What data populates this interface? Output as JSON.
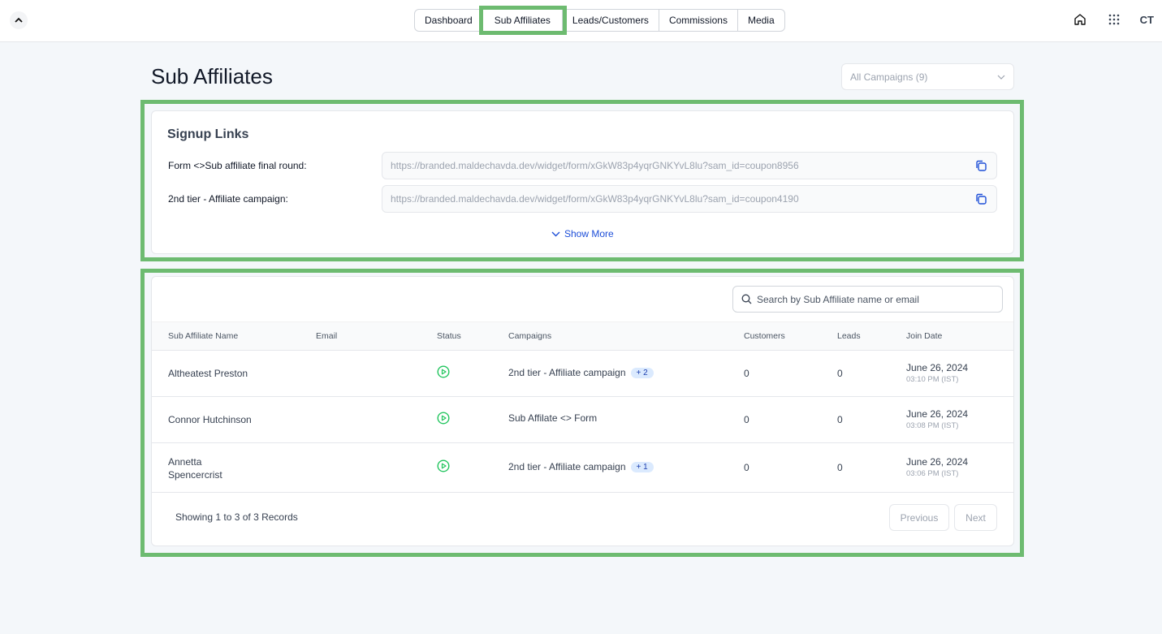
{
  "nav": {
    "tabs": [
      "Dashboard",
      "Sub Affiliates",
      "Leads/Customers",
      "Commissions",
      "Media"
    ],
    "active": "Sub Affiliates"
  },
  "header": {
    "avatar_initials": "CT"
  },
  "page": {
    "title": "Sub Affiliates",
    "campaign_filter": "All Campaigns (9)"
  },
  "signup": {
    "title": "Signup Links",
    "links": [
      {
        "label": "Form <>Sub affiliate final round:",
        "url": "https://branded.maldechavda.dev/widget/form/xGkW83p4yqrGNKYvL8lu?sam_id=coupon8956"
      },
      {
        "label": "2nd tier - Affiliate campaign:",
        "url": "https://branded.maldechavda.dev/widget/form/xGkW83p4yqrGNKYvL8lu?sam_id=coupon4190"
      }
    ],
    "show_more": "Show More"
  },
  "table": {
    "search_placeholder": "Search by Sub Affiliate name or email",
    "columns": {
      "name": "Sub Affiliate Name",
      "email": "Email",
      "status": "Status",
      "campaigns": "Campaigns",
      "customers": "Customers",
      "leads": "Leads",
      "join_date": "Join Date"
    },
    "rows": [
      {
        "name": "Altheatest Preston",
        "campaign": "2nd tier - Affiliate campaign",
        "extra": "+ 2",
        "customers": "0",
        "leads": "0",
        "date": "June 26, 2024",
        "time": "03:10 PM (IST)"
      },
      {
        "name": "Connor Hutchinson",
        "campaign": "Sub Affilate <> Form",
        "extra": "",
        "customers": "0",
        "leads": "0",
        "date": "June 26, 2024",
        "time": "03:08 PM (IST)"
      },
      {
        "name_line1": "Annetta",
        "name_line2": "Spencercrist",
        "campaign": "2nd tier - Affiliate campaign",
        "extra": "+ 1",
        "customers": "0",
        "leads": "0",
        "date": "June 26, 2024",
        "time": "03:06 PM (IST)"
      }
    ],
    "footer": "Showing 1 to 3 of 3 Records",
    "previous": "Previous",
    "next": "Next"
  },
  "colors": {
    "highlight": "#6dbb70",
    "status_active": "#22c55e",
    "link": "#1d4ed8"
  }
}
